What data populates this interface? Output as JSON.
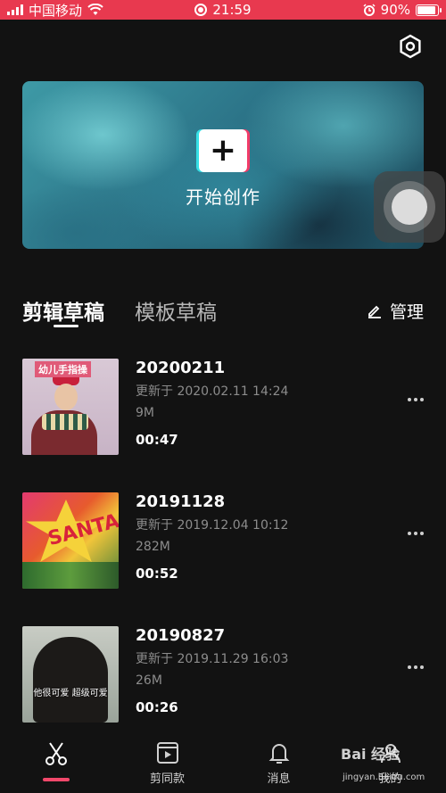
{
  "status_bar": {
    "carrier": "中国移动",
    "time": "21:59",
    "battery_percent": "90%",
    "battery_level": 0.9,
    "bg_color": "#e8394f"
  },
  "hero": {
    "create_label": "开始创作",
    "plus_symbol": "+"
  },
  "tabs": {
    "items": [
      {
        "label": "剪辑草稿",
        "active": true
      },
      {
        "label": "模板草稿",
        "active": false
      }
    ],
    "manage_label": "管理"
  },
  "drafts": [
    {
      "title": "20200211",
      "updated": "更新于 2020.02.11 14:24",
      "size": "9M",
      "duration": "00:47",
      "thumb_caption": "幼儿手指操"
    },
    {
      "title": "20191128",
      "updated": "更新于 2019.12.04 10:12",
      "size": "282M",
      "duration": "00:52",
      "thumb_caption": "SANTA"
    },
    {
      "title": "20190827",
      "updated": "更新于 2019.11.29 16:03",
      "size": "26M",
      "duration": "00:26",
      "thumb_caption": "他很可爱 超级可爱"
    }
  ],
  "bottom_nav": {
    "items": [
      {
        "label": "",
        "icon": "scissors-icon",
        "active": true
      },
      {
        "label": "剪同款",
        "icon": "video-template-icon",
        "active": false
      },
      {
        "label": "消息",
        "icon": "bell-icon",
        "active": false
      },
      {
        "label": "我的",
        "icon": "user-icon",
        "active": false
      }
    ],
    "accent": "#f2486b"
  },
  "watermark": {
    "brand": "Bai 经验",
    "url": "jingyan.baidu.com"
  }
}
